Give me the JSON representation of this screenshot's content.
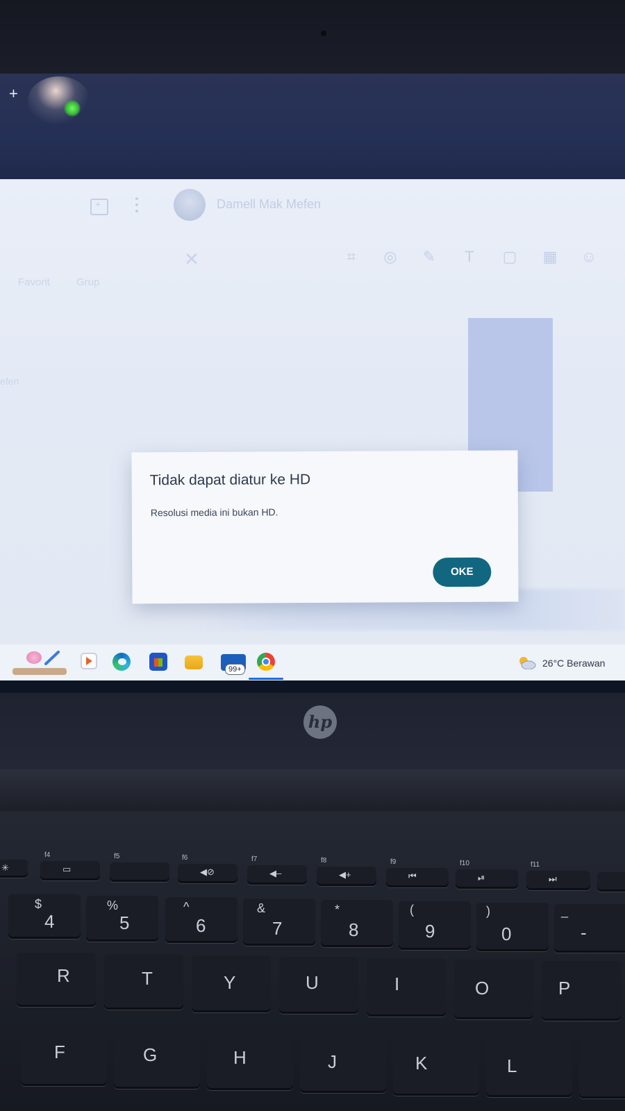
{
  "window": {
    "new_tab_symbol": "+"
  },
  "chat": {
    "contact_name": "Damell Mak Mefen",
    "tabs": [
      "Favorit",
      "Grup"
    ],
    "side_contact_snippet": "efen"
  },
  "editor_tools": [
    "crop-icon",
    "filter-icon",
    "pen-icon",
    "text-icon",
    "shape-icon",
    "blur-icon",
    "emoji-icon"
  ],
  "dialog": {
    "title": "Tidak dapat diatur ke HD",
    "message": "Resolusi media ini bukan HD.",
    "ok_label": "OKE"
  },
  "taskbar": {
    "icons": [
      "widgets-flower-icon",
      "media-player-icon",
      "edge-icon",
      "store-icon",
      "file-explorer-icon",
      "mail-icon",
      "chrome-icon"
    ],
    "mail_badge": "99+",
    "weather": "26°C  Berawan",
    "accent_color": "#1e6fd9"
  },
  "laptop": {
    "brand": "hp",
    "keys_row_f": [
      {
        "label": "f4",
        "glyph": "▭"
      },
      {
        "label": "f5",
        "glyph": ""
      },
      {
        "label": "f6",
        "glyph": "◀⊘"
      },
      {
        "label": "f7",
        "glyph": "◀–"
      },
      {
        "label": "f8",
        "glyph": "◀+"
      },
      {
        "label": "f9",
        "glyph": "⏮"
      },
      {
        "label": "f10",
        "glyph": "⏯"
      },
      {
        "label": "f11",
        "glyph": "⏭"
      }
    ],
    "keys_row_num": [
      {
        "main": "4",
        "sub": "$"
      },
      {
        "main": "5",
        "sub": "%"
      },
      {
        "main": "6",
        "sub": "^"
      },
      {
        "main": "7",
        "sub": "&"
      },
      {
        "main": "8",
        "sub": "*"
      },
      {
        "main": "9",
        "sub": "("
      },
      {
        "main": "0",
        "sub": ")"
      },
      {
        "main": "-",
        "sub": "_"
      }
    ],
    "keys_row_top": [
      "R",
      "T",
      "Y",
      "U",
      "I",
      "O",
      "P"
    ],
    "keys_row_home": [
      "F",
      "G",
      "H",
      "J",
      "K",
      "L"
    ]
  },
  "colors": {
    "dialog_button": "#11677f",
    "dialog_bg": "#f6f8fc"
  }
}
